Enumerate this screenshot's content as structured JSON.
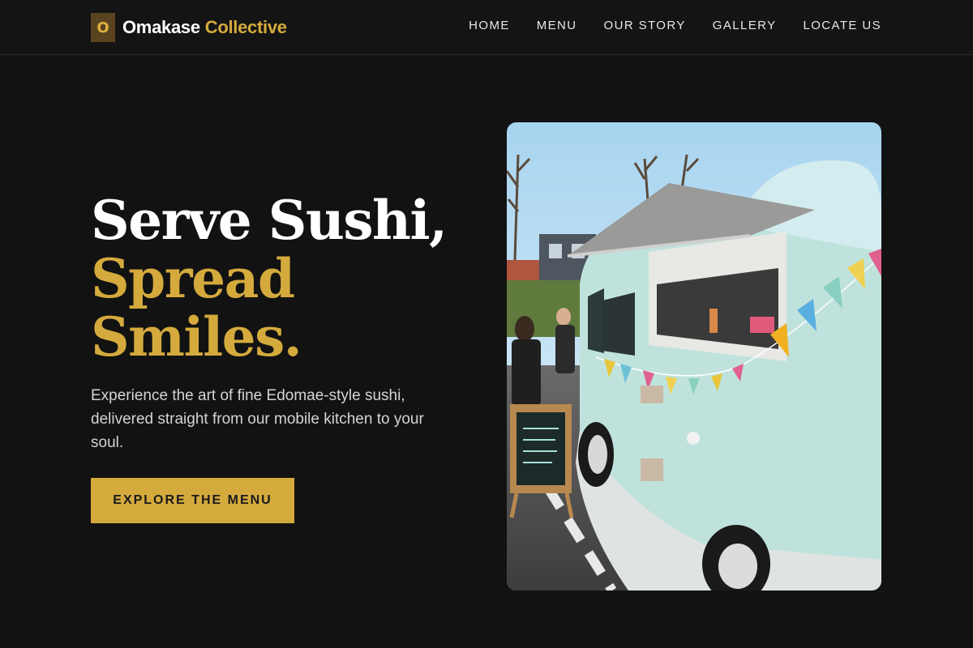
{
  "brand": {
    "mark": "O",
    "name_part1": "Omakase",
    "name_part2": "Collective"
  },
  "nav": {
    "items": [
      {
        "label": "HOME"
      },
      {
        "label": "MENU"
      },
      {
        "label": "OUR STORY"
      },
      {
        "label": "GALLERY"
      },
      {
        "label": "LOCATE US"
      }
    ]
  },
  "hero": {
    "title_line1": "Serve Sushi,",
    "title_line2": "Spread",
    "title_line3": "Smiles.",
    "subtitle": "Experience the art of fine Edomae-style sushi, delivered straight from our mobile kitchen to your soul.",
    "cta_label": "EXPLORE THE MENU"
  },
  "colors": {
    "accent": "#d4aa3d",
    "background": "#121212",
    "truck": "#bfe3dc"
  }
}
